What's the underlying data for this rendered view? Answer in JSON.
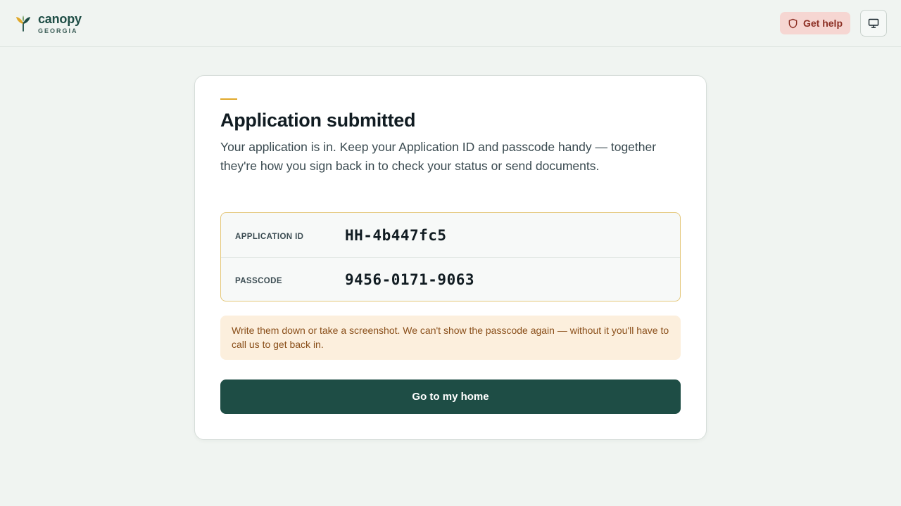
{
  "brand": {
    "name": "canopy",
    "sub": "GEORGIA",
    "logo_icon": "leaf-sprout-icon"
  },
  "header": {
    "help_label": "Get help",
    "help_icon": "shield-icon",
    "screen_icon": "monitor-icon"
  },
  "card": {
    "title": "Application submitted",
    "intro": "Your application is in. Keep your Application ID and passcode handy — together they're how you sign back in to check your status or send documents.",
    "credentials": [
      {
        "label": "APPLICATION ID",
        "value": "HH-4b447fc5"
      },
      {
        "label": "PASSCODE",
        "value": "9456-0171-9063"
      }
    ],
    "notice": "Write them down or take a screenshot. We can't show the passcode again — without it you'll have to call us to get back in.",
    "primary_button": "Go to my home"
  },
  "colors": {
    "brand_green": "#1e4d45",
    "accent_gold": "#e0a82a",
    "help_bg": "#f6d6d2",
    "help_text": "#8c2f24",
    "notice_bg": "#fcefdd",
    "notice_text": "#8a4f1a"
  }
}
